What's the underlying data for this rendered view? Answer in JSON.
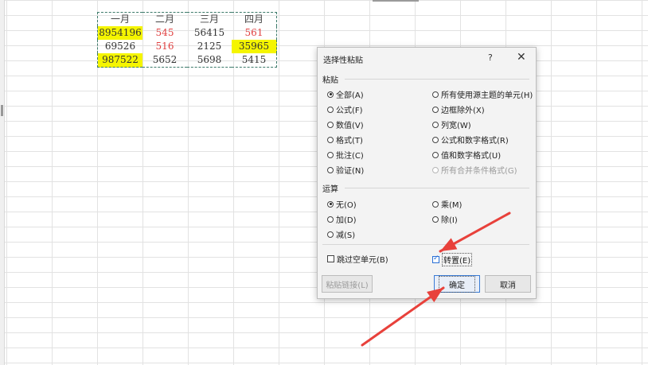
{
  "sheet": {
    "rows": [
      [
        {
          "v": "一月",
          "hdr": true
        },
        {
          "v": "二月",
          "hdr": true
        },
        {
          "v": "三月",
          "hdr": true
        },
        {
          "v": "四月",
          "hdr": true
        }
      ],
      [
        {
          "v": "8954196",
          "hl": true
        },
        {
          "v": "545",
          "red": true
        },
        {
          "v": "56415"
        },
        {
          "v": "561",
          "red": true
        }
      ],
      [
        {
          "v": "69526"
        },
        {
          "v": "516",
          "red": true
        },
        {
          "v": "2125"
        },
        {
          "v": "35965",
          "hl": true
        }
      ],
      [
        {
          "v": "987522",
          "hl": true
        },
        {
          "v": "5652"
        },
        {
          "v": "5698"
        },
        {
          "v": "5415"
        }
      ]
    ],
    "highlight_color": "#f5f500",
    "red_text_color": "#e04040"
  },
  "dialog": {
    "title": "选择性粘贴",
    "help_label": "?",
    "close_label": "✕",
    "paste_section": "粘贴",
    "paste_left": [
      {
        "label": "全部(A)",
        "checked": true
      },
      {
        "label": "公式(F)"
      },
      {
        "label": "数值(V)"
      },
      {
        "label": "格式(T)"
      },
      {
        "label": "批注(C)"
      },
      {
        "label": "验证(N)"
      }
    ],
    "paste_right": [
      {
        "label": "所有使用源主题的单元(H)"
      },
      {
        "label": "边框除外(X)"
      },
      {
        "label": "列宽(W)"
      },
      {
        "label": "公式和数字格式(R)"
      },
      {
        "label": "值和数字格式(U)"
      },
      {
        "label": "所有合并条件格式(G)",
        "disabled": true
      }
    ],
    "op_section": "运算",
    "op_left": [
      {
        "label": "无(O)",
        "checked": true
      },
      {
        "label": "加(D)"
      },
      {
        "label": "减(S)"
      }
    ],
    "op_right": [
      {
        "label": "乘(M)"
      },
      {
        "label": "除(I)"
      }
    ],
    "skip_blanks": "跳过空单元(B)",
    "transpose": "转置(E)",
    "paste_link": "粘贴链接(L)",
    "ok": "确定",
    "cancel": "取消"
  },
  "annotation_color": "#e8413b"
}
